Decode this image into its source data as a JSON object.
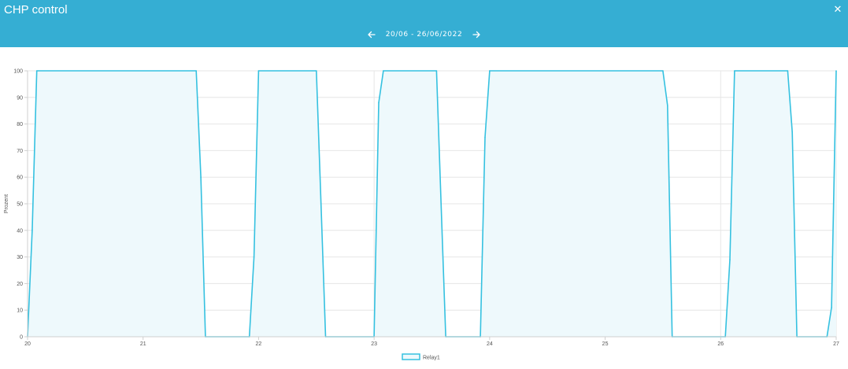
{
  "window": {
    "title": "CHP control",
    "close_icon": "close-icon",
    "header_color": "#35aed3"
  },
  "nav": {
    "prev_icon": "arrow-left-icon",
    "next_icon": "arrow-right-icon",
    "date_range": "20/06 - 26/06/2022"
  },
  "chart_data": {
    "type": "area",
    "ylabel": "Prozent",
    "xlabel": "",
    "ylim": [
      0,
      100
    ],
    "xlim": [
      20,
      27
    ],
    "yticks": [
      0,
      10,
      20,
      30,
      40,
      50,
      60,
      70,
      80,
      90,
      100
    ],
    "xticks": [
      20,
      21,
      22,
      23,
      24,
      25,
      26,
      27
    ],
    "grid": true,
    "legend_position": "bottom-center",
    "series": [
      {
        "name": "Relay1",
        "color": "#35c1e0",
        "fill": "#eef9fc",
        "x": [
          20.0,
          20.04,
          20.08,
          21.46,
          21.5,
          21.54,
          21.92,
          21.96,
          22.0,
          22.5,
          22.54,
          22.58,
          23.0,
          23.04,
          23.08,
          23.54,
          23.58,
          23.62,
          23.92,
          23.96,
          24.0,
          25.5,
          25.54,
          25.58,
          26.04,
          26.08,
          26.12,
          26.58,
          26.62,
          26.66,
          26.92,
          26.96,
          27.0
        ],
        "values": [
          0,
          40,
          100,
          100,
          60,
          0,
          0,
          30,
          100,
          100,
          50,
          0,
          0,
          88,
          100,
          100,
          50,
          0,
          0,
          75,
          100,
          100,
          87,
          0,
          0,
          29,
          100,
          100,
          77,
          0,
          0,
          11,
          100
        ]
      }
    ]
  }
}
